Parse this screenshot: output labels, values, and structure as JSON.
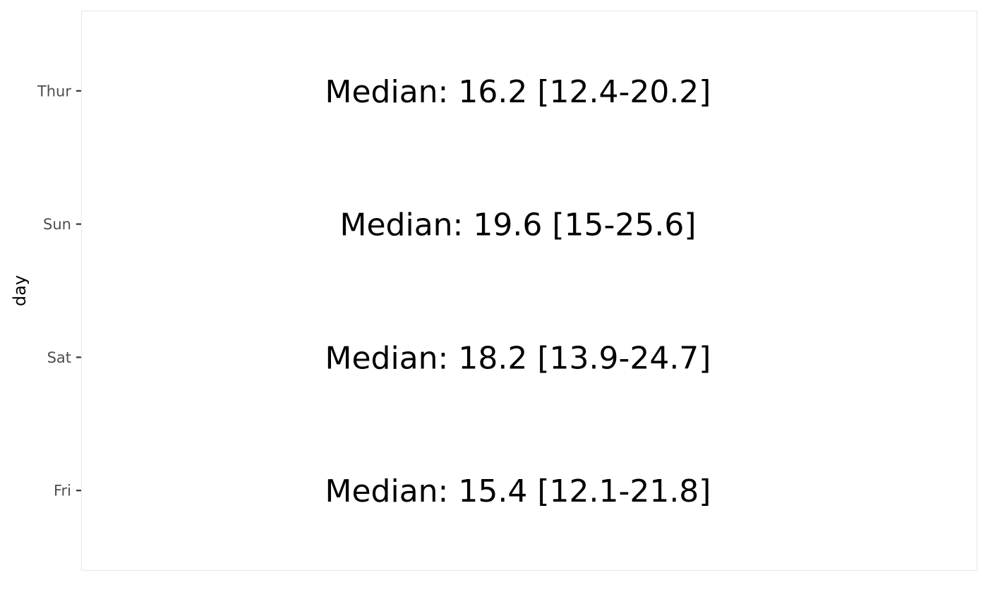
{
  "chart_data": {
    "type": "table",
    "ylabel": "day",
    "categories": [
      "Fri",
      "Sat",
      "Sun",
      "Thur"
    ],
    "annotations": [
      {
        "category": "Fri",
        "text": "Median: 15.4 [12.1-21.8]",
        "median": 15.4,
        "q1": 12.1,
        "q3": 21.8
      },
      {
        "category": "Sat",
        "text": "Median: 18.2 [13.9-24.7]",
        "median": 18.2,
        "q1": 13.9,
        "q3": 24.7
      },
      {
        "category": "Sun",
        "text": "Median: 19.6 [15-25.6]",
        "median": 19.6,
        "q1": 15,
        "q3": 25.6
      },
      {
        "category": "Thur",
        "text": "Median: 16.2 [12.4-20.2]",
        "median": 16.2,
        "q1": 12.4,
        "q3": 20.2
      }
    ],
    "grid": false,
    "text_color": "#000000",
    "tick_label_color": "#4d4d4d",
    "panel_border_color": "#ebebeb"
  }
}
